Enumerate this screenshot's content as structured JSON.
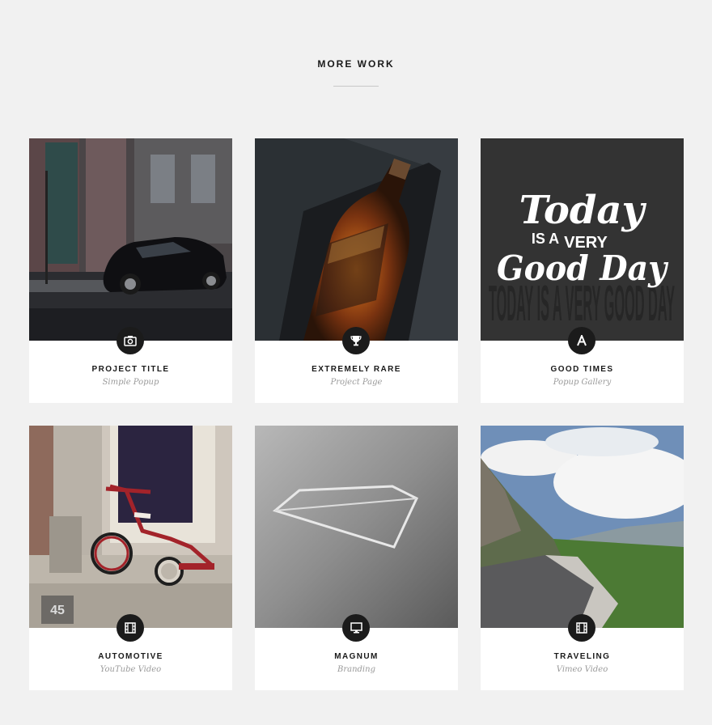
{
  "section": {
    "title": "MORE WORK"
  },
  "cards": [
    {
      "title": "PROJECT TITLE",
      "subtitle": "Simple Popup",
      "icon": "camera-icon"
    },
    {
      "title": "EXTREMELY RARE",
      "subtitle": "Project Page",
      "icon": "trophy-icon"
    },
    {
      "title": "GOOD TIMES",
      "subtitle": "Popup Gallery",
      "icon": "letter-a-icon",
      "poster": {
        "bg": "TODAY IS A VERY GOOD DAY",
        "line1": "Today",
        "line2": "IS A",
        "line3": "VERY",
        "line4": "Good Day"
      }
    },
    {
      "title": "AUTOMOTIVE",
      "subtitle": "YouTube Video",
      "icon": "film-icon",
      "sign": "45"
    },
    {
      "title": "MAGNUM",
      "subtitle": "Branding",
      "icon": "monitor-icon"
    },
    {
      "title": "TRAVELING",
      "subtitle": "Vimeo Video",
      "icon": "film-icon"
    }
  ]
}
